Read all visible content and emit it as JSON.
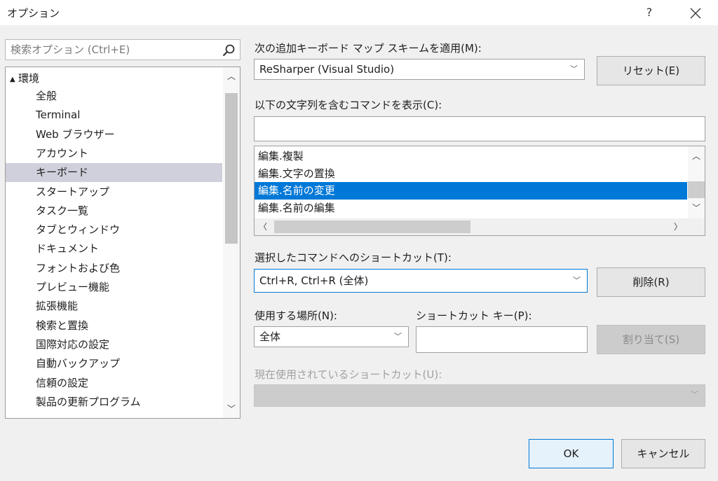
{
  "window": {
    "title": "オプション",
    "help_label": "?"
  },
  "search": {
    "placeholder": "検索オプション (Ctrl+E)",
    "value": ""
  },
  "tree": {
    "root_label": "環境",
    "items": [
      {
        "label": "全般"
      },
      {
        "label": "Terminal"
      },
      {
        "label": "Web ブラウザー"
      },
      {
        "label": "アカウント"
      },
      {
        "label": "キーボード",
        "selected": true
      },
      {
        "label": "スタートアップ"
      },
      {
        "label": "タスク一覧"
      },
      {
        "label": "タブとウィンドウ"
      },
      {
        "label": "ドキュメント"
      },
      {
        "label": "フォントおよび色"
      },
      {
        "label": "プレビュー機能"
      },
      {
        "label": "拡張機能"
      },
      {
        "label": "検索と置換"
      },
      {
        "label": "国際対応の設定"
      },
      {
        "label": "自動バックアップ"
      },
      {
        "label": "信頼の設定"
      },
      {
        "label": "製品の更新プログラム"
      }
    ]
  },
  "keyboard": {
    "scheme_label": "次の追加キーボード マップ スキームを適用(M):",
    "scheme_value": "ReSharper (Visual Studio)",
    "reset_label": "リセット(E)",
    "filter_label": "以下の文字列を含むコマンドを表示(C):",
    "filter_value": "",
    "commands": [
      {
        "label": "編集.複製"
      },
      {
        "label": "編集.文字の置換"
      },
      {
        "label": "編集.名前の変更",
        "selected": true
      },
      {
        "label": "編集.名前の編集"
      }
    ],
    "shortcuts_label": "選択したコマンドへのショートカット(T):",
    "shortcut_value": "Ctrl+R, Ctrl+R (全体)",
    "delete_label": "削除(R)",
    "scope_label": "使用する場所(N):",
    "scope_value": "全体",
    "shortcut_key_label": "ショートカット キー(P):",
    "shortcut_key_value": "",
    "assign_label": "割り当て(S)",
    "used_by_label": "現在使用されているショートカット(U):",
    "used_by_value": ""
  },
  "footer": {
    "ok_label": "OK",
    "cancel_label": "キャンセル"
  },
  "colors": {
    "selection": "#0078d7",
    "tree_selection": "#d0d0dc",
    "background": "#f0f0f0"
  }
}
